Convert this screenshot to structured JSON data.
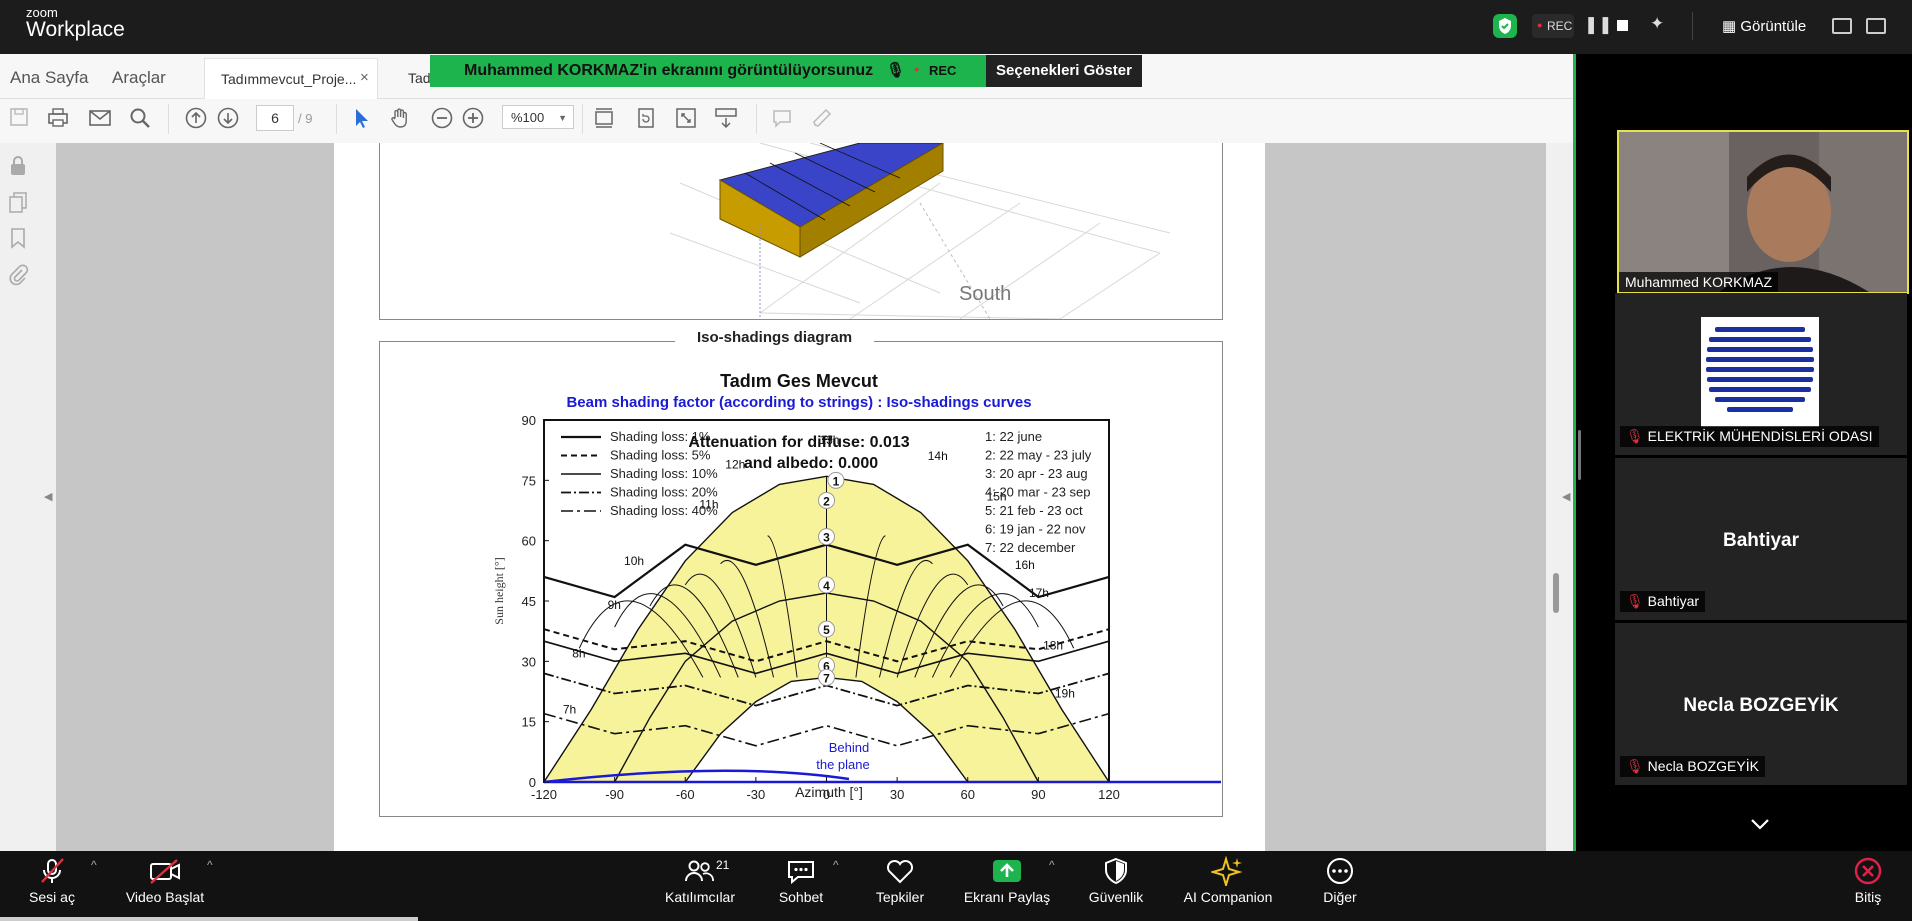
{
  "zoom": {
    "logo_small": "zoom",
    "logo_big": "Workplace",
    "rec": "REC",
    "view_label": "Görüntüle"
  },
  "viewer": {
    "tabs": [
      "Ana Sayfa",
      "Araçlar"
    ],
    "doc_tab": "Tadımmevcut_Proje...",
    "doc_tab2": "Tad",
    "close_icon": "×",
    "page_current": "6",
    "page_total": "/ 9",
    "zoom_value": "%100"
  },
  "share_banner": {
    "text": "Muhammed KORKMAZ'in ekranını görüntülüyorsunuz",
    "rec": "REC",
    "options": "Seçenekleri Göster"
  },
  "document": {
    "south_label": "South",
    "section_title": "Iso-shadings diagram",
    "chart_title": "Tadım Ges Mevcut",
    "chart_subtitle": "Beam shading factor (according to strings) : Iso-shadings curves",
    "attenuation_line1": "Attenuation for diffuse: 0.013",
    "attenuation_line2": "and albedo: 0.000",
    "behind_line1": "Behind",
    "behind_line2": "the plane",
    "ylabel": "Sun height [°]",
    "xlabel": "Azimuth [°]"
  },
  "chart_data": {
    "type": "line",
    "title": "Tadım Ges Mevcut",
    "subtitle": "Beam shading factor (according to strings) : Iso-shadings curves",
    "xlabel": "Azimuth [°]",
    "ylabel": "Sun height [°]",
    "xlim": [
      -120,
      120
    ],
    "ylim": [
      0,
      90
    ],
    "x_ticks": [
      "-120",
      "-90",
      "-60",
      "-30",
      "0",
      "30",
      "60",
      "90",
      "120"
    ],
    "y_ticks": [
      "0",
      "15",
      "30",
      "45",
      "60",
      "75",
      "90"
    ],
    "shading_legend": [
      "Shading loss: 1%",
      "Shading loss: 5%",
      "Shading loss: 10%",
      "Shading loss: 20%",
      "Shading loss: 40%"
    ],
    "date_legend": [
      "1: 22 june",
      "2: 22 may - 23 july",
      "3: 20 apr - 23 aug",
      "4: 20 mar - 23 sep",
      "5: 21 feb - 23 oct",
      "6: 19 jan - 22 nov",
      "7: 22 december"
    ],
    "sun_paths": [
      {
        "name": "1",
        "x": [
          -120,
          -100,
          -80,
          -60,
          -40,
          -20,
          0,
          20,
          40,
          60,
          80,
          100,
          120
        ],
        "y": [
          0,
          18,
          38,
          55,
          67,
          74,
          76,
          74,
          67,
          55,
          38,
          18,
          0
        ]
      },
      {
        "name": "4",
        "x": [
          -90,
          -75,
          -60,
          -40,
          -20,
          0,
          20,
          40,
          60,
          75,
          90
        ],
        "y": [
          0,
          16,
          30,
          40,
          45,
          47,
          45,
          40,
          30,
          16,
          0
        ]
      },
      {
        "name": "7",
        "x": [
          -60,
          -45,
          -30,
          -15,
          0,
          15,
          30,
          45,
          60
        ],
        "y": [
          0,
          12,
          20,
          25,
          26,
          25,
          20,
          12,
          0
        ]
      }
    ],
    "hour_labels": [
      "7h",
      "8h",
      "9h",
      "10h",
      "11h",
      "12h",
      "13h",
      "14h",
      "15h",
      "16h",
      "17h",
      "18h",
      "19h"
    ],
    "curve_markers": [
      "1",
      "2",
      "3",
      "4",
      "5",
      "6",
      "7"
    ]
  },
  "participants": [
    {
      "name": "Muhammed KORKMAZ",
      "type": "video"
    },
    {
      "name": "ELEKTRİK MÜHENDİSLERİ ODASI",
      "type": "logo"
    },
    {
      "name": "Bahtiyar",
      "big": "Bahtiyar",
      "type": "name"
    },
    {
      "name": "Necla BOZGEYİK",
      "big": "Necla BOZGEYİK",
      "type": "name"
    }
  ],
  "bottom": {
    "mic": "Sesi aç",
    "video": "Video Başlat",
    "participants": "Katılımcılar",
    "participants_count": "21",
    "chat": "Sohbet",
    "reactions": "Tepkiler",
    "share": "Ekranı Paylaş",
    "security": "Güvenlik",
    "ai": "AI Companion",
    "more": "Diğer",
    "end": "Bitiş"
  },
  "colors": {
    "share_green": "#1db34d",
    "sun_area": "#f7f39a",
    "chart_blue": "#1a1ad6",
    "end_red": "#e0204b"
  }
}
